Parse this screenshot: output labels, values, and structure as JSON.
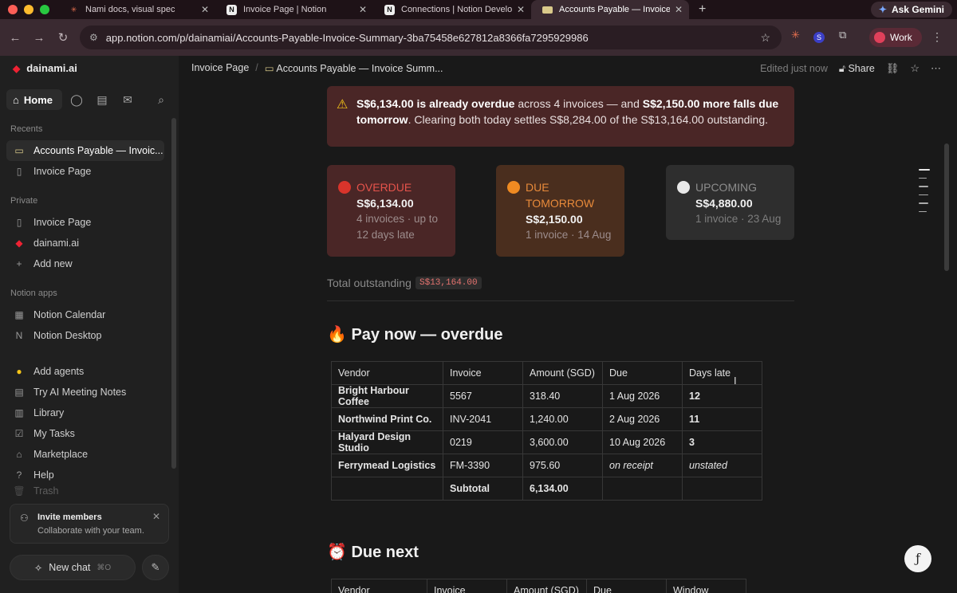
{
  "browser": {
    "tabs": [
      {
        "label": "Nami docs, visual spec",
        "favicon": "asterisk-icon",
        "active": false
      },
      {
        "label": "Invoice Page | Notion",
        "favicon": "notion-icon",
        "active": false
      },
      {
        "label": "Connections | Notion Develop",
        "favicon": "notion-icon",
        "active": false
      },
      {
        "label": "Accounts Payable — Invoice S",
        "favicon": "card-icon",
        "active": true
      }
    ],
    "ask_gemini": "Ask Gemini",
    "url": "app.notion.com/p/dainamiai/Accounts-Payable-Invoice-Summary-3ba75458e627812a8366fa7295929986",
    "profile": "Work"
  },
  "sidebar": {
    "workspace": "dainami.ai",
    "home": "Home",
    "recents_title": "Recents",
    "recents": [
      "Accounts Payable — Invoic...",
      "Invoice Page"
    ],
    "private_title": "Private",
    "private": [
      "Invoice Page",
      "dainami.ai",
      "Add new"
    ],
    "apps_title": "Notion apps",
    "apps": [
      "Notion Calendar",
      "Notion Desktop"
    ],
    "tools": [
      "Add agents",
      "Try AI Meeting Notes",
      "Library",
      "My Tasks",
      "Marketplace",
      "Help",
      "Trash"
    ],
    "invite_title": "Invite members",
    "invite_sub": "Collaborate with your team.",
    "new_chat": "New chat",
    "new_chat_kbd": "⌘O"
  },
  "topbar": {
    "crumb1": "Invoice Page",
    "crumb2": "Accounts Payable — Invoice Summ...",
    "edited": "Edited just now",
    "share": "Share"
  },
  "alert": {
    "part1": "S$6,134.00 is already overdue",
    "part2": " across 4 invoices — and ",
    "part3": "S$2,150.00 more falls due tomorrow",
    "part4": ". Clearing both today settles S$8,284.00 of the S$13,164.00 outstanding."
  },
  "cards": [
    {
      "label": "OVERDUE",
      "amount": "S$6,134.00",
      "sub": "4 invoices · up to 12 days late",
      "accent": "#e5534b",
      "bg": "#4a2626"
    },
    {
      "label": "DUE TOMORROW",
      "amount": "S$2,150.00",
      "sub": "1 invoice · 14 Aug",
      "accent": "#e88a3a",
      "bg": "#4a2e1e"
    },
    {
      "label": "UPCOMING",
      "amount": "S$4,880.00",
      "sub": "1 invoice · 23 Aug",
      "accent": "#8d8d8d",
      "bg": "#2e2e2e"
    }
  ],
  "total": {
    "label": "Total outstanding",
    "value": "S$13,164.00"
  },
  "overdue_section": {
    "heading": "Pay now — overdue",
    "columns": [
      "Vendor",
      "Invoice",
      "Amount (SGD)",
      "Due",
      "Days late"
    ],
    "rows": [
      [
        "Bright Harbour Coffee",
        "5567",
        "318.40",
        "1 Aug 2026",
        "12"
      ],
      [
        "Northwind Print Co.",
        "INV-2041",
        "1,240.00",
        "2 Aug 2026",
        "11"
      ],
      [
        "Halyard Design Studio",
        "0219",
        "3,600.00",
        "10 Aug 2026",
        "3"
      ],
      [
        "Ferrymead Logistics",
        "FM-3390",
        "975.60",
        "on receipt",
        "unstated"
      ]
    ],
    "subtotal_label": "Subtotal",
    "subtotal_value": "6,134.00"
  },
  "due_next_section": {
    "heading": "Due next",
    "columns": [
      "Vendor",
      "Invoice",
      "Amount (SGD)",
      "Due",
      "Window"
    ]
  }
}
